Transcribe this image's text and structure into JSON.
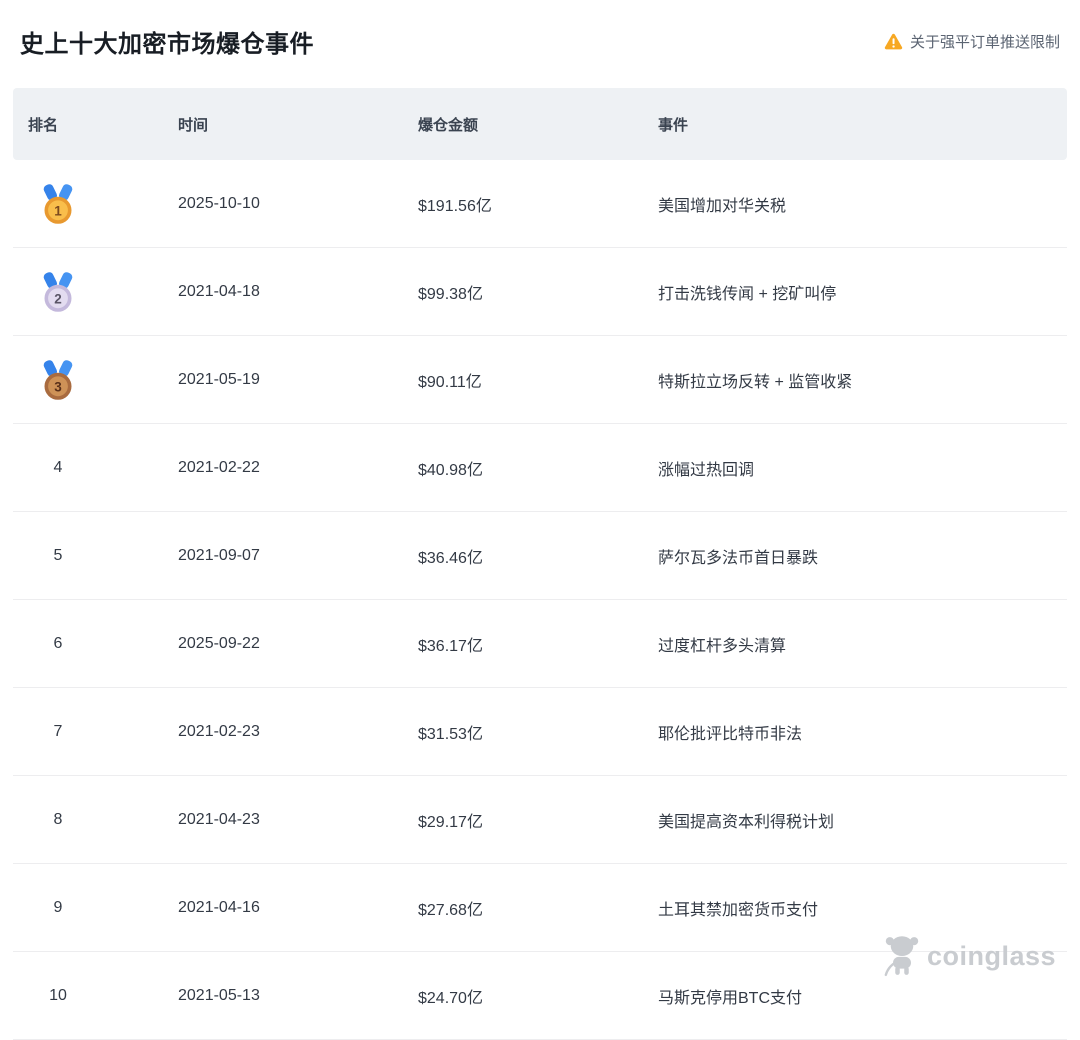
{
  "page": {
    "title": "史上十大加密市场爆仓事件",
    "notice_label": "关于强平订单推送限制"
  },
  "table": {
    "headers": [
      "排名",
      "时间",
      "爆仓金额",
      "事件"
    ],
    "rows": [
      {
        "rank": "1",
        "medal": "gold",
        "date": "2025-10-10",
        "amount": "$191.56亿",
        "event": "美国增加对华关税"
      },
      {
        "rank": "2",
        "medal": "silver",
        "date": "2021-04-18",
        "amount": "$99.38亿",
        "event": "打击洗钱传闻 + 挖矿叫停"
      },
      {
        "rank": "3",
        "medal": "bronze",
        "date": "2021-05-19",
        "amount": "$90.11亿",
        "event": "特斯拉立场反转 + 监管收紧"
      },
      {
        "rank": "4",
        "date": "2021-02-22",
        "amount": "$40.98亿",
        "event": "涨幅过热回调"
      },
      {
        "rank": "5",
        "date": "2021-09-07",
        "amount": "$36.46亿",
        "event": "萨尔瓦多法币首日暴跌"
      },
      {
        "rank": "6",
        "date": "2025-09-22",
        "amount": "$36.17亿",
        "event": "过度杠杆多头清算"
      },
      {
        "rank": "7",
        "date": "2021-02-23",
        "amount": "$31.53亿",
        "event": "耶伦批评比特币非法"
      },
      {
        "rank": "8",
        "date": "2021-04-23",
        "amount": "$29.17亿",
        "event": "美国提高资本利得税计划"
      },
      {
        "rank": "9",
        "date": "2021-04-16",
        "amount": "$27.68亿",
        "event": "土耳其禁加密货币支付"
      },
      {
        "rank": "10",
        "date": "2021-05-13",
        "amount": "$24.70亿",
        "event": "马斯克停用BTC支付"
      }
    ]
  },
  "watermark": {
    "brand": "coinglass"
  },
  "colors": {
    "warning_orange": "#F7A823",
    "header_bg": "#EEF1F4",
    "row_border": "#EDEDEF",
    "title_text": "#181D24",
    "cell_text": "#333A45",
    "notice_text": "#5B6472",
    "watermark_gray": "#C9CCD0",
    "ribbon_blue": "#4694F2",
    "ribbon_blue_dark": "#3583EA",
    "medals": {
      "gold": {
        "ring": "#E8992F",
        "face": "#F9BE4B",
        "num": "#7C4A1E"
      },
      "silver": {
        "ring": "#C4B9DC",
        "face": "#E3DCF0",
        "num": "#5A5566"
      },
      "bronze": {
        "ring": "#A96B3F",
        "face": "#CE9257",
        "num": "#59301A"
      }
    }
  }
}
